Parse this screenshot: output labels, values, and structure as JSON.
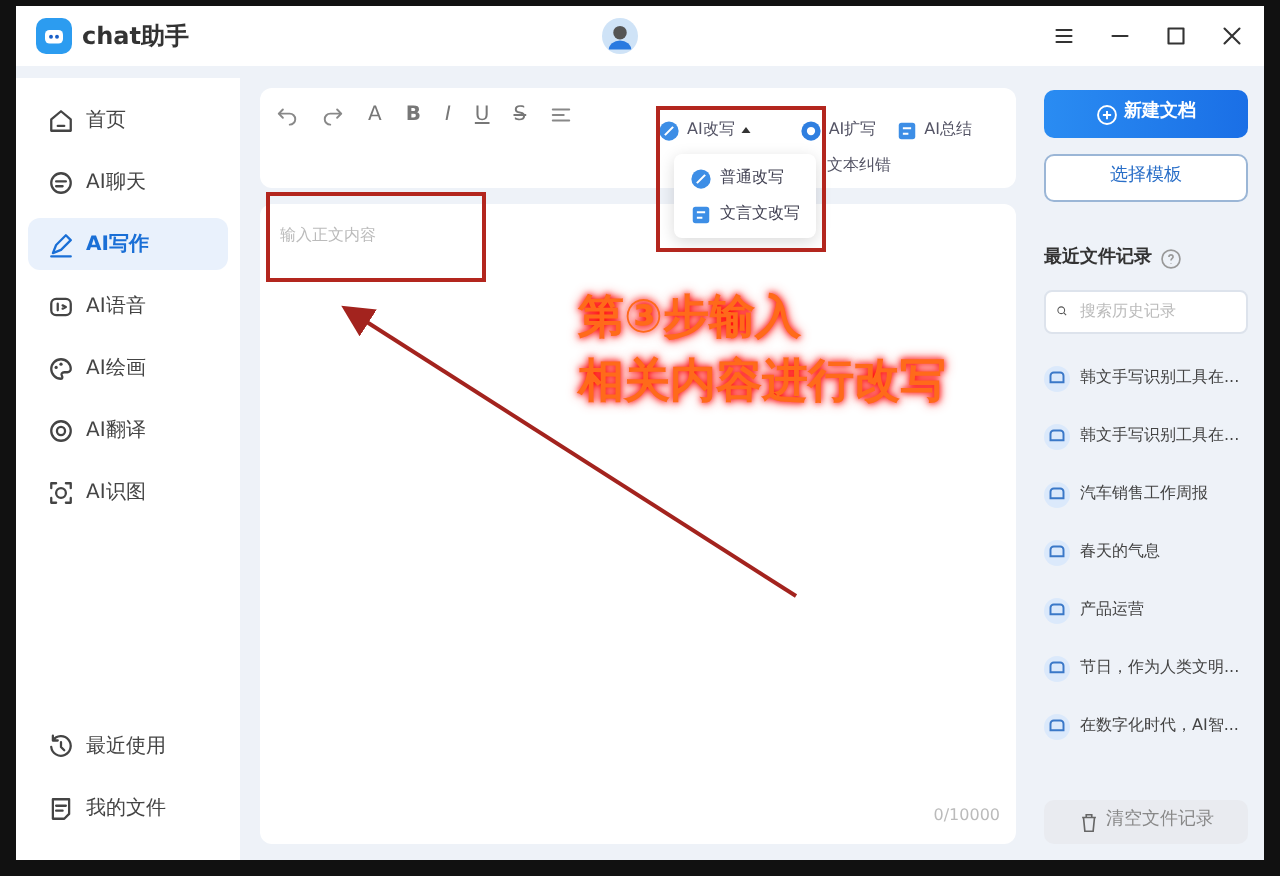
{
  "window": {
    "title": "chat助手"
  },
  "sidebar": {
    "items": [
      {
        "label": "首页",
        "selected": false
      },
      {
        "label": "AI聊天",
        "selected": false
      },
      {
        "label": "AI写作",
        "selected": true
      },
      {
        "label": "AI语音",
        "selected": false
      },
      {
        "label": "AI绘画",
        "selected": false
      },
      {
        "label": "AI翻译",
        "selected": false
      },
      {
        "label": "AI识图",
        "selected": false
      }
    ],
    "bottom_items": [
      {
        "label": "最近使用"
      },
      {
        "label": "我的文件"
      }
    ]
  },
  "toolbar": {
    "format_buttons": [
      "A",
      "B",
      "I",
      "U",
      "S"
    ],
    "ai_tools": [
      {
        "label": "AI改写"
      },
      {
        "label": "AI扩写"
      },
      {
        "label": "AI总结"
      }
    ],
    "proofread": "文本纠错",
    "rewrite_menu": {
      "open": true,
      "items": [
        "普通改写",
        "文言文改写"
      ]
    }
  },
  "editor": {
    "placeholder": "输入正文内容",
    "counter": "0/10000"
  },
  "right_panel": {
    "new_button": "新建文档",
    "template_button": "选择模板",
    "recent_title": "最近文件记录",
    "search_placeholder": "搜索历史记录",
    "records": [
      "韩文手写识别工具在...",
      "韩文手写识别工具在...",
      "汽车销售工作周报",
      "春天的气息",
      "产品运营",
      "节日，作为人类文明...",
      "在数字化时代，AI智..."
    ],
    "clear_button": "清空文件记录"
  },
  "annotation": {
    "lines": [
      "第③步输入",
      "相关内容进行改写"
    ]
  }
}
